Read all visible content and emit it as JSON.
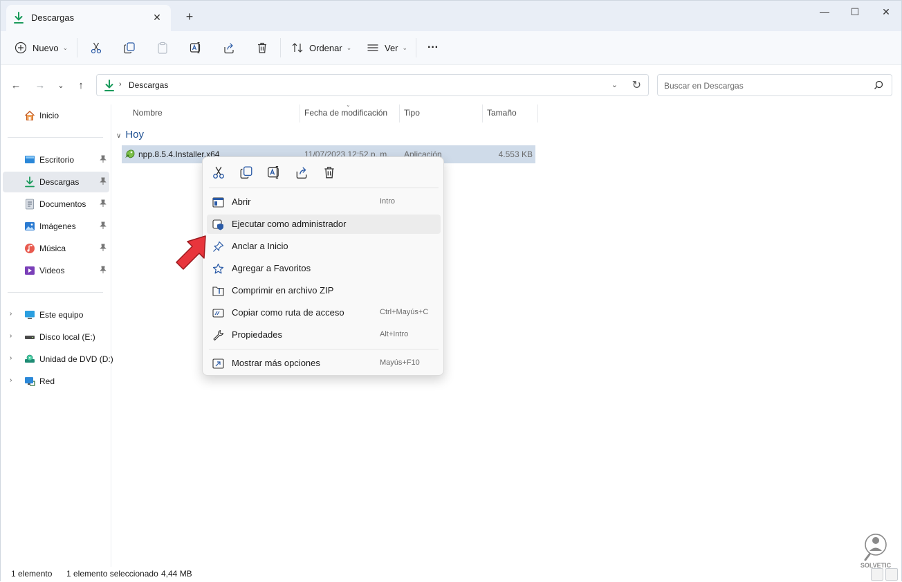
{
  "window": {
    "tab_title": "Descargas",
    "tab_close": "✕",
    "new_tab": "+",
    "controls": {
      "minimize": "—",
      "maximize": "☐",
      "close": "✕"
    }
  },
  "toolbar": {
    "new_label": "Nuevo",
    "sort_label": "Ordenar",
    "view_label": "Ver",
    "more_label": "···"
  },
  "address": {
    "crumb": "Descargas",
    "search_placeholder": "Buscar en Descargas"
  },
  "sidebar": {
    "home": "Inicio",
    "pinned": [
      {
        "label": "Escritorio"
      },
      {
        "label": "Descargas"
      },
      {
        "label": "Documentos"
      },
      {
        "label": "Imágenes"
      },
      {
        "label": "Música"
      },
      {
        "label": "Videos"
      }
    ],
    "devices": [
      {
        "label": "Este equipo"
      },
      {
        "label": "Disco local (E:)"
      },
      {
        "label": "Unidad de DVD (D:)"
      },
      {
        "label": "Red"
      }
    ]
  },
  "columns": {
    "name": "Nombre",
    "modified": "Fecha de modificación",
    "type": "Tipo",
    "size": "Tamaño"
  },
  "group": {
    "label": "Hoy"
  },
  "file": {
    "name": "npp.8.5.4.Installer.x64",
    "modified": "11/07/2023 12:52 p. m.",
    "type": "Aplicación",
    "size": "4.553 KB"
  },
  "context_menu": {
    "items": [
      {
        "label": "Abrir",
        "shortcut": "Intro"
      },
      {
        "label": "Ejecutar como administrador",
        "shortcut": ""
      },
      {
        "label": "Anclar a Inicio",
        "shortcut": ""
      },
      {
        "label": "Agregar a Favoritos",
        "shortcut": ""
      },
      {
        "label": "Comprimir en archivo ZIP",
        "shortcut": ""
      },
      {
        "label": "Copiar como ruta de acceso",
        "shortcut": "Ctrl+Mayús+C"
      },
      {
        "label": "Propiedades",
        "shortcut": "Alt+Intro"
      },
      {
        "label": "Mostrar más opciones",
        "shortcut": "Mayús+F10"
      }
    ]
  },
  "status": {
    "count": "1 elemento",
    "selection": "1 elemento seleccionado",
    "selection_size": "4,44 MB"
  },
  "watermark": {
    "text": "SOLVETIC"
  },
  "colors": {
    "accent": "#1d4f91",
    "download_green": "#1a9a5b",
    "selection": "#cfdbe9",
    "arrow_red": "#e8353c"
  }
}
